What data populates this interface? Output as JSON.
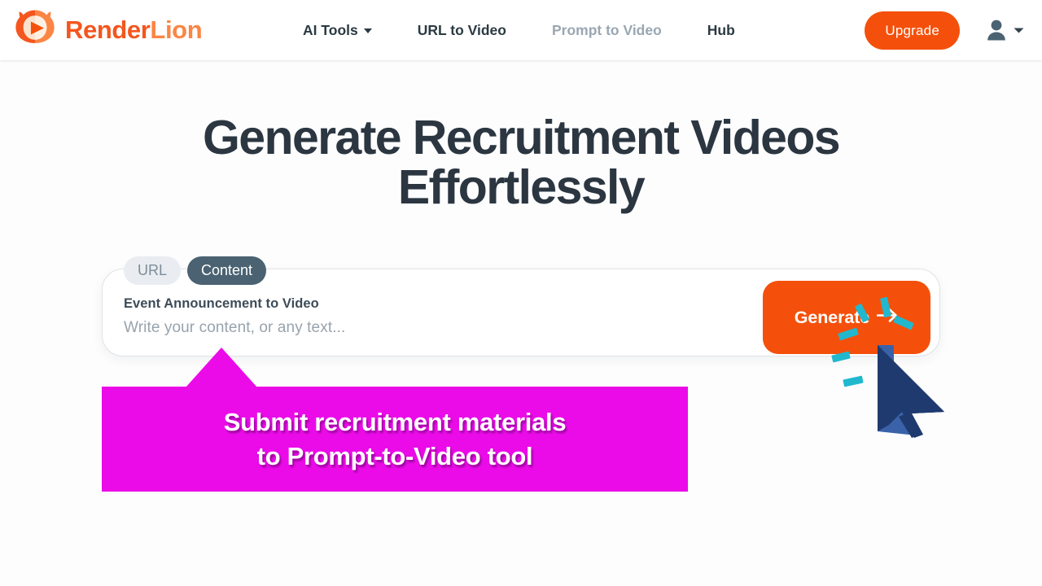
{
  "header": {
    "logo": {
      "icon": "lion-play-logo-icon",
      "text_primary": "Render",
      "text_secondary": "Lion",
      "color_primary": "#F4561E",
      "color_secondary": "#FB8544"
    },
    "nav": [
      {
        "label": "AI Tools",
        "has_dropdown": true,
        "muted": false,
        "name": "nav-item-ai-tools"
      },
      {
        "label": "URL to Video",
        "has_dropdown": false,
        "muted": false,
        "name": "nav-item-url-to-video"
      },
      {
        "label": "Prompt to Video",
        "has_dropdown": false,
        "muted": true,
        "name": "nav-item-prompt-to-video"
      },
      {
        "label": "Hub",
        "has_dropdown": false,
        "muted": false,
        "name": "nav-item-hub"
      }
    ],
    "upgrade_label": "Upgrade",
    "upgrade_color": "#F4500B",
    "account_icon": "user-avatar-icon",
    "account_caret_icon": "chevron-down-icon"
  },
  "hero": {
    "headline_line1": "Generate Recruitment Videos",
    "headline_line2": "Effortlessly",
    "headline_color": "#2b3641"
  },
  "input_card": {
    "tabs": [
      {
        "label": "URL",
        "active": false,
        "name": "tab-url"
      },
      {
        "label": "Content",
        "active": true,
        "name": "tab-content"
      }
    ],
    "active_tab_color": "#4a6271",
    "inactive_tab_color": "#E9EDF1",
    "field_label": "Event Announcement to Video",
    "field_value": "",
    "field_placeholder": "Write your content, or any text...",
    "generate_label": "Generate",
    "generate_arrow_icon": "arrow-right-icon",
    "generate_color": "#F4500B"
  },
  "annotation": {
    "callout_line1": "Submit recruitment materials",
    "callout_line2": "to Prompt-to-Video tool",
    "callout_bg_color": "#EB0BE8",
    "callout_text_color": "#FFFFFF",
    "cursor_icon": "mouse-pointer-cursor",
    "cursor_color": "#1F3A6E",
    "click_burst_icon": "click-burst-icon",
    "click_burst_color": "#21B8CE"
  }
}
